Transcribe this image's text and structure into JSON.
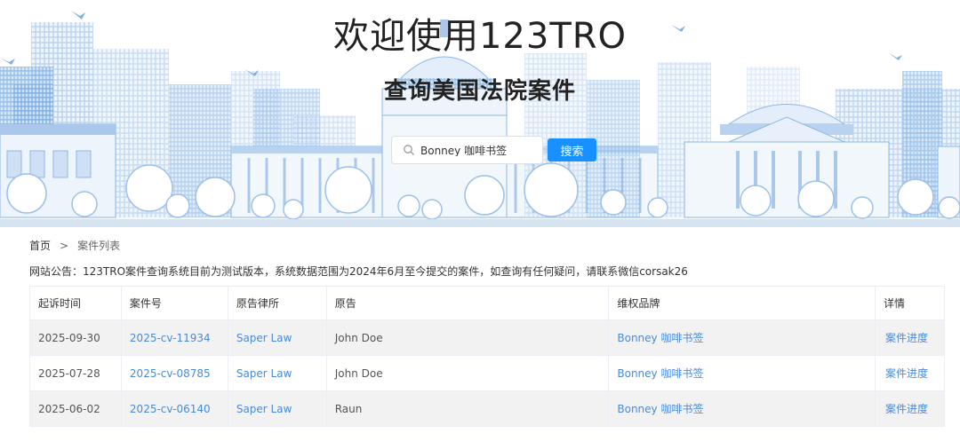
{
  "hero": {
    "title": "欢迎使用123TRO",
    "subtitle": "查询美国法院案件"
  },
  "search": {
    "value": "Bonney 咖啡书签",
    "button_label": "搜索",
    "icon": "search-icon"
  },
  "breadcrumb": {
    "home": "首页",
    "separator": ">",
    "current": "案件列表"
  },
  "notice": "网站公告：123TRO案件查询系统目前为测试版本，系统数据范围为2024年6月至今提交的案件，如查询有任何疑问，请联系微信corsak26",
  "table": {
    "headers": [
      "起诉时间",
      "案件号",
      "原告律所",
      "原告",
      "维权品牌",
      "详情"
    ],
    "rows": [
      {
        "date": "2025-09-30",
        "case_no": "2025-cv-11934",
        "firm": "Saper Law",
        "plaintiff": "John Doe",
        "brand": "Bonney 咖啡书签",
        "detail": "案件进度"
      },
      {
        "date": "2025-07-28",
        "case_no": "2025-cv-08785",
        "firm": "Saper Law",
        "plaintiff": "John Doe",
        "brand": "Bonney 咖啡书签",
        "detail": "案件进度"
      },
      {
        "date": "2025-06-02",
        "case_no": "2025-cv-06140",
        "firm": "Saper Law",
        "plaintiff": "Raun",
        "brand": "Bonney 咖啡书签",
        "detail": "案件进度"
      }
    ]
  },
  "colors": {
    "accent": "#1890ff",
    "link": "#4a8bd6",
    "skyline": "#6fa3dc"
  }
}
